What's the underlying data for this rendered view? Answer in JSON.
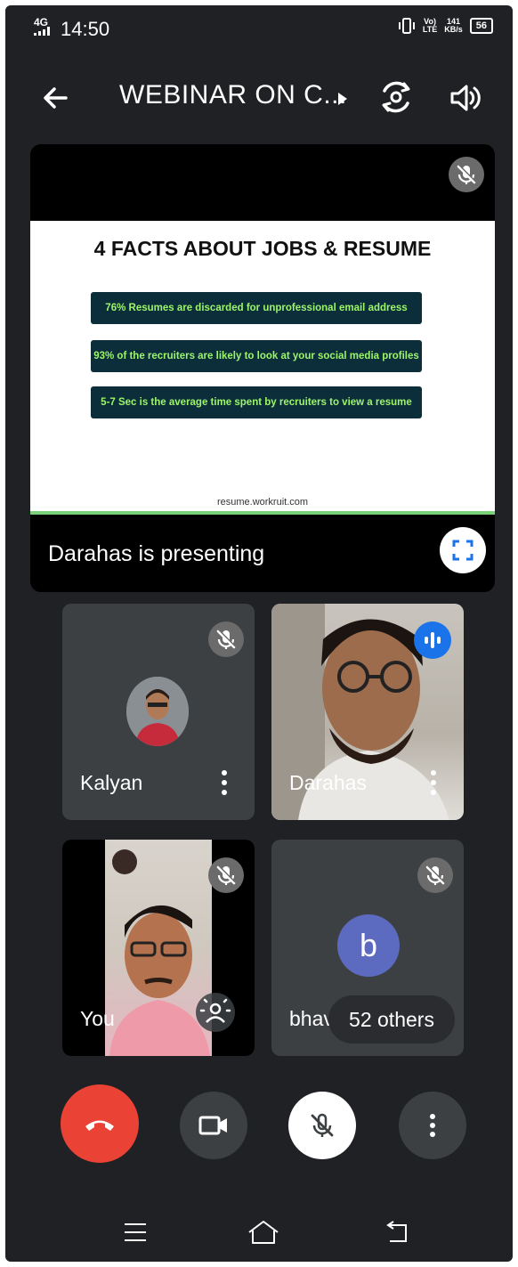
{
  "status_bar": {
    "network": "4G",
    "time": "14:50",
    "volte": "Vo)\nLTE",
    "speed": "141\nKB/s",
    "battery": "56"
  },
  "header": {
    "title": "WEBINAR ON C..."
  },
  "presentation": {
    "slide_title": "4 FACTS ABOUT JOBS & RESUME",
    "facts": [
      "76% Resumes are discarded for unprofessional email address",
      "93% of the recruiters are likely to look at your social media profiles",
      "5-7 Sec is the average time spent by recruiters to view a resume"
    ],
    "slide_footer": "resume.workruit.com",
    "presenting_label": "Darahas is presenting"
  },
  "participants": [
    {
      "name": "Kalyan"
    },
    {
      "name": "Darahas"
    },
    {
      "name": "You"
    },
    {
      "name": "bhav",
      "avatar_letter": "b"
    }
  ],
  "others_label": "52 others",
  "colors": {
    "background": "#202124",
    "tile": "#3c4043",
    "end_call": "#ea4335",
    "speaking": "#1a73e8",
    "fact_bg": "#0b2e3a",
    "fact_text": "#9df56a",
    "avatar_b": "#5c6bc0"
  },
  "icons": [
    "back-arrow-icon",
    "chevron-right-icon",
    "camera-switch-icon",
    "speaker-icon",
    "mic-off-icon",
    "fullscreen-icon",
    "more-vert-icon",
    "audio-wave-icon",
    "effects-icon",
    "end-call-icon",
    "video-camera-icon",
    "menu-icon",
    "home-icon",
    "nav-back-icon"
  ]
}
